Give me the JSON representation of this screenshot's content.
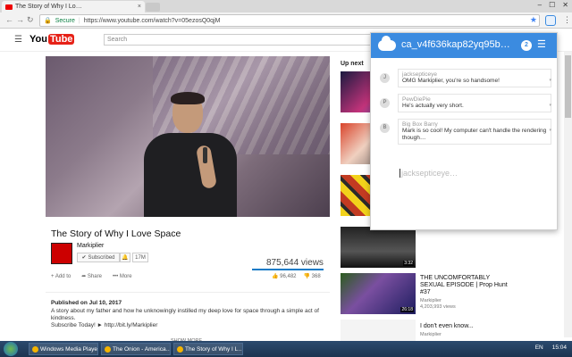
{
  "browser": {
    "tab_title": "The Story of Why I Lo…",
    "tab_close": "×",
    "secure_label": "Secure",
    "url": "https://www.youtube.com/watch?v=05ezosQ0qjM",
    "win_min": "–",
    "win_max": "☐",
    "win_close": "✕"
  },
  "youtube": {
    "logo_you": "You",
    "logo_tube": "Tube",
    "search_placeholder": "Search"
  },
  "video": {
    "title": "The Story of Why I Love Space",
    "channel": "Markiplier",
    "subscribe_label": "Subscribed",
    "bell": "🔔",
    "sub_count": "17M",
    "views": "875,644 views",
    "add_to": "Add to",
    "share": "Share",
    "more": "More",
    "likes": "96,482",
    "dislikes": "368",
    "published": "Published on Jul 10, 2017",
    "description": "A story about my father and how he unknowingly instilled my deep love for space through a simple act of kindness.",
    "subscribe_line": "Subscribe Today! ► http://bit.ly/Markiplier",
    "show_more": "SHOW MORE"
  },
  "sidebar": {
    "up_next": "Up next",
    "items": [
      {
        "duration": ""
      },
      {
        "duration": ""
      },
      {
        "duration": ""
      },
      {
        "duration": "3:32"
      },
      {
        "title": "THE UNCOMFORTABLY SEXUAL EPISODE | Prop Hunt #37",
        "channel": "Markiplier",
        "views": "4,203,993 views",
        "duration": "26:18"
      },
      {
        "title": "I don't even know...",
        "channel": "Markiplier",
        "views": "3,621,127 views"
      }
    ]
  },
  "popup": {
    "room": "ca_v4f636kap82yq95b…",
    "count": "2",
    "messages": [
      {
        "initial": "J",
        "author": "jacksepticeye",
        "body": "OMG Markiplier, you're so handsome!"
      },
      {
        "initial": "P",
        "author": "PewDiePie",
        "body": "He's actually very short."
      },
      {
        "initial": "B",
        "author": "Big Box Barry",
        "body": "Mark is so cool! My computer can't handle the rendering though…"
      }
    ],
    "compose_placeholder": "jacksepticeye…"
  },
  "taskbar": {
    "tasks": [
      "Windows Media Player",
      "The Onion - America…",
      "The Story of Why I L…"
    ],
    "lang": "EN",
    "time": "15:04"
  }
}
